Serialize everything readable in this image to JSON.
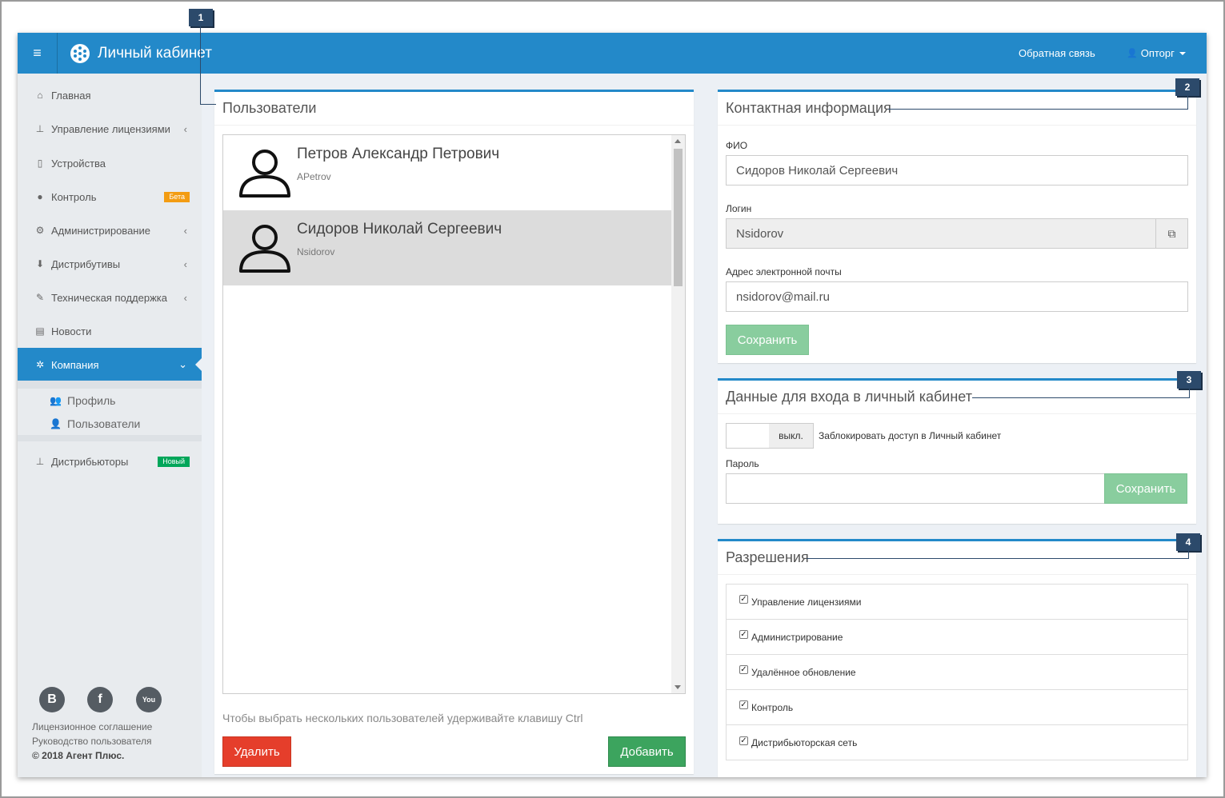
{
  "header": {
    "menu_icon": "hamburger-icon",
    "title": "Личный кабинет",
    "feedback": "Обратная связь",
    "user": "Опторг",
    "accent_color": "#2389c9"
  },
  "sidebar": {
    "items": [
      {
        "label": "Главная",
        "icon": "home-icon"
      },
      {
        "label": "Управление лицензиями",
        "icon": "sitemap-icon"
      },
      {
        "label": "Устройства",
        "icon": "mobile-icon"
      },
      {
        "label": "Контроль",
        "icon": "globe-icon",
        "badge": "Бета"
      },
      {
        "label": "Администрирование",
        "icon": "cogs-icon"
      },
      {
        "label": "Дистрибутивы",
        "icon": "download-icon"
      },
      {
        "label": "Техническая поддержка",
        "icon": "wrench-icon"
      },
      {
        "label": "Новости",
        "icon": "newspaper-icon"
      },
      {
        "label": "Компания",
        "icon": "gear-icon"
      },
      {
        "label": "Дистрибьюторы",
        "icon": "sitemap-icon",
        "badge": "Новый"
      }
    ],
    "submenu": [
      {
        "label": "Профиль",
        "icon": "users-icon"
      },
      {
        "label": "Пользователи",
        "icon": "user-plus-icon"
      }
    ],
    "footer": {
      "license": "Лицензионное соглашение",
      "guide": "Руководство пользователя",
      "copyright": "© 2018 Агент Плюс."
    }
  },
  "users_panel": {
    "title": "Пользователи",
    "users": [
      {
        "name": "Петров Александр Петрович",
        "login": "APetrov",
        "selected": false
      },
      {
        "name": "Сидоров Николай Сергеевич",
        "login": "Nsidorov",
        "selected": true
      }
    ],
    "hint": "Чтобы выбрать нескольких пользователей удерживайте клавишу Ctrl",
    "delete_label": "Удалить",
    "add_label": "Добавить"
  },
  "contact_panel": {
    "title": "Контактная информация",
    "fio_label": "ФИО",
    "fio_value": "Сидоров Николай Сергеевич",
    "login_label": "Логин",
    "login_value": "Nsidorov",
    "email_label": "Адрес электронной почты",
    "email_value": "nsidorov@mail.ru",
    "save_label": "Сохранить"
  },
  "login_panel": {
    "title": "Данные для входа в личный кабинет",
    "toggle_state": "выкл.",
    "block_label": "Заблокировать доступ в Личный кабинет",
    "password_label": "Пароль",
    "save_label": "Сохранить"
  },
  "permissions_panel": {
    "title": "Разрешения",
    "items": [
      {
        "label": "Управление лицензиями",
        "checked": true
      },
      {
        "label": "Администрирование",
        "checked": true
      },
      {
        "label": "Удалённое обновление",
        "checked": true
      },
      {
        "label": "Контроль",
        "checked": true
      },
      {
        "label": "Дистрибьюторская сеть",
        "checked": true
      }
    ]
  },
  "callouts": [
    "1",
    "2",
    "3",
    "4"
  ]
}
